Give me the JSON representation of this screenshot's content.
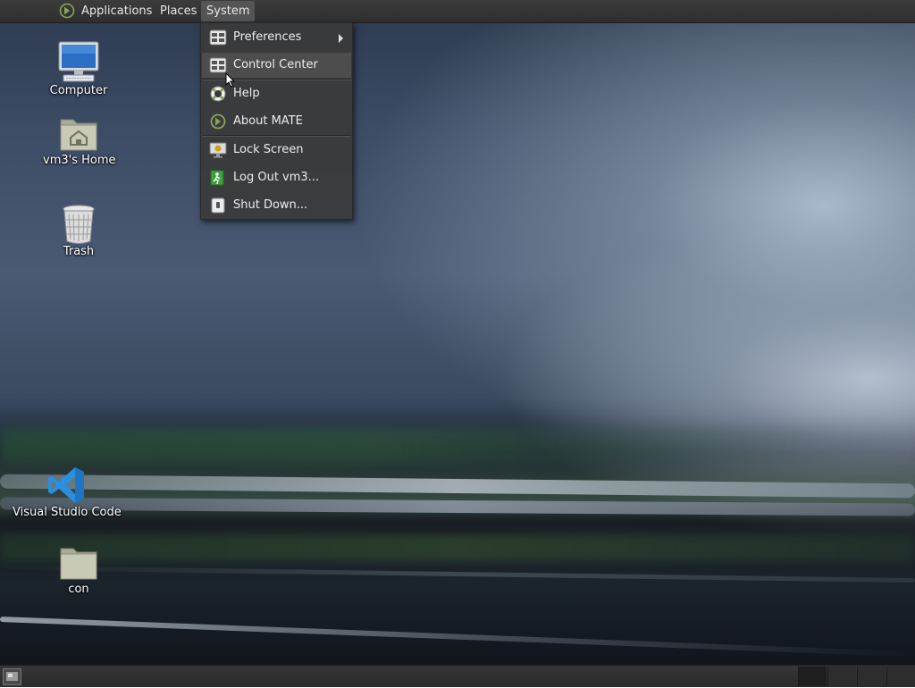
{
  "top_panel": {
    "menus": [
      {
        "label": "Applications"
      },
      {
        "label": "Places"
      },
      {
        "label": "System"
      }
    ]
  },
  "desktop": {
    "icons": [
      {
        "label": "Computer",
        "icon": "computer-icon"
      },
      {
        "label": "vm3's Home",
        "icon": "home-folder-icon"
      },
      {
        "label": "Trash",
        "icon": "trash-icon"
      },
      {
        "label": "Visual Studio Code",
        "icon": "vscode-icon"
      },
      {
        "label": "con",
        "icon": "folder-icon"
      }
    ]
  },
  "system_menu": {
    "items": [
      {
        "label": "Preferences",
        "icon": "preferences-icon",
        "has_submenu": true
      },
      {
        "label": "Control Center",
        "icon": "control-center-icon",
        "highlighted": true
      },
      {
        "label": "Help",
        "icon": "help-lifebuoy-icon"
      },
      {
        "label": "About MATE",
        "icon": "mate-logo-icon"
      },
      {
        "label": "Lock Screen",
        "icon": "lock-screen-icon"
      },
      {
        "label": "Log Out vm3...",
        "icon": "logout-icon"
      },
      {
        "label": "Shut Down...",
        "icon": "shutdown-icon"
      }
    ]
  },
  "colors": {
    "panel": "#2e2e2e",
    "menu_bg": "#3a3a3a",
    "menu_hover": "#4d4d4d",
    "vscode_blue": "#2b8fe0",
    "mate_green": "#87a556"
  }
}
